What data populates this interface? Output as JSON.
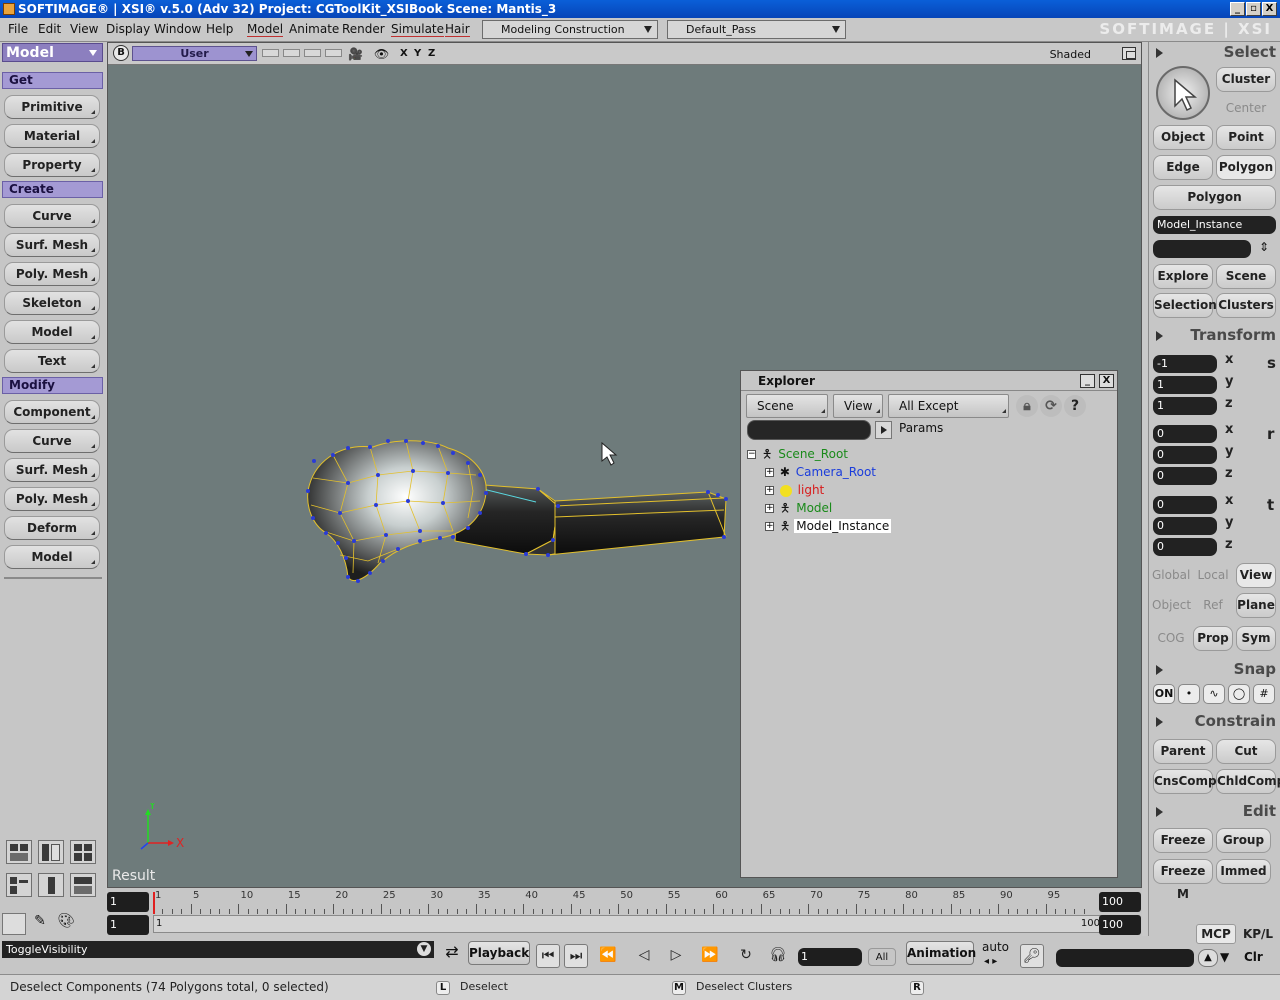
{
  "window": {
    "title": "SOFTIMAGE® | XSI® v.5.0 (Adv 32) Project: CGToolKit_XSIBook     Scene: Mantis_3",
    "brand": "SOFTIMAGE | XSI",
    "controls": [
      "_",
      "▫",
      "X"
    ]
  },
  "menubar": {
    "items": [
      "File",
      "Edit",
      "View",
      "Display",
      "Window",
      "Help"
    ],
    "module_items": [
      "Model",
      "Animate",
      "Render",
      "Simulate",
      "Hair"
    ],
    "construction_mode": "Modeling Construction Mode",
    "render_pass": "Default_Pass"
  },
  "left_panel": {
    "mode": "Model",
    "sections": {
      "get": "Get",
      "create": "Create",
      "modify": "Modify"
    },
    "get_buttons": [
      "Primitive",
      "Material",
      "Property"
    ],
    "create_buttons": [
      "Curve",
      "Surf. Mesh",
      "Poly. Mesh",
      "Skeleton",
      "Model",
      "Text"
    ],
    "modify_buttons": [
      "Component",
      "Curve",
      "Surf. Mesh",
      "Poly. Mesh",
      "Deform",
      "Model"
    ]
  },
  "viewport": {
    "b_label": "B",
    "camera": "User",
    "axes_labels": [
      "X",
      "Y",
      "Z"
    ],
    "display_mode": "Shaded",
    "result_label": "Result",
    "gizmo": {
      "x": "X",
      "y": "Y"
    }
  },
  "explorer": {
    "title": "Explorer",
    "minimize": "_",
    "close": "X",
    "buttons": [
      "Scene Root",
      "View",
      "All Except Params"
    ],
    "icons": {
      "lock": "lock-icon",
      "refresh": "refresh-icon",
      "help": "?"
    },
    "search_value": "",
    "tree": {
      "root": {
        "label": "Scene_Root",
        "color": "#1a8a1a"
      },
      "children": [
        {
          "label": "Camera_Root",
          "color": "#1a3cdb"
        },
        {
          "label": "light",
          "color": "#d81b1b"
        },
        {
          "label": "Model",
          "color": "#1a8a1a"
        },
        {
          "label": "Model_Instance",
          "color": "#111111"
        }
      ]
    }
  },
  "right_panel": {
    "select_header": "Select",
    "select_buttons": {
      "cluster": "Cluster",
      "center": "Center",
      "object": "Object",
      "point": "Point",
      "edge": "Edge",
      "polygon": "Polygon",
      "polygon_dropdown": "Polygon"
    },
    "selected_object": "Model_Instance",
    "name_field": "",
    "explore_buttons": [
      "Explore",
      "Scene",
      "Selection",
      "Clusters"
    ],
    "transform_header": "Transform",
    "scale": {
      "x": "-1",
      "y": "1",
      "z": "1"
    },
    "rotate": {
      "x": "0",
      "y": "0",
      "z": "0"
    },
    "translate": {
      "x": "0",
      "y": "0",
      "z": "0"
    },
    "axis_labels": [
      "x",
      "y",
      "z"
    ],
    "srt_icons": [
      "s",
      "r",
      "t"
    ],
    "ref_buttons": {
      "global": "Global",
      "local": "Local",
      "view": "View",
      "object": "Object",
      "ref": "Ref",
      "plane": "Plane",
      "cog": "COG",
      "prop": "Prop",
      "sym": "Sym"
    },
    "snap_header": "Snap",
    "snap_on": "ON",
    "constrain_header": "Constrain",
    "constrain_buttons": [
      "Parent",
      "Cut",
      "CnsComp",
      "ChldComp"
    ],
    "edit_header": "Edit",
    "edit_buttons": [
      "Freeze",
      "Group",
      "Freeze M",
      "Immed"
    ]
  },
  "timeline": {
    "start_field": "1",
    "current_field": "1",
    "end_field": "100",
    "range_end_field": "100",
    "range_start_label": "1",
    "range_end_label": "100",
    "ticks": [
      "1",
      "5",
      "10",
      "15",
      "20",
      "25",
      "30",
      "35",
      "40",
      "45",
      "50",
      "55",
      "60",
      "65",
      "70",
      "75",
      "80",
      "85",
      "90",
      "95"
    ],
    "tick_min": 1,
    "tick_max": 100,
    "current_frame": 1
  },
  "bottom_bar": {
    "command": "ToggleVisibility",
    "playback": "Playback",
    "frame_field": "1",
    "all_label": "All",
    "animation": "Animation",
    "auto_label": "auto",
    "mcp": "MCP",
    "kpl": "KP/L",
    "clr": "Clr"
  },
  "status_bar": {
    "message": "Deselect Components (74 Polygons total, 0 selected)",
    "l_tag": "L",
    "l_action": "Deselect",
    "m_tag": "M",
    "m_action": "Deselect Clusters",
    "r_tag": "R",
    "r_action": ""
  }
}
